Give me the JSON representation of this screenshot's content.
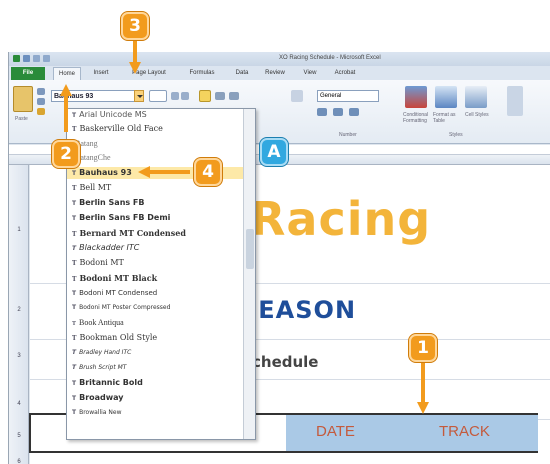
{
  "window": {
    "title": "XO Racing Schedule - Microsoft Excel"
  },
  "ribbon": {
    "tabs": [
      {
        "label": "File"
      },
      {
        "label": "Home"
      },
      {
        "label": "Insert"
      },
      {
        "label": "Page Layout"
      },
      {
        "label": "Formulas"
      },
      {
        "label": "Data"
      },
      {
        "label": "Review"
      },
      {
        "label": "View"
      },
      {
        "label": "Acrobat"
      }
    ],
    "paste_label": "Paste",
    "number_format": "General",
    "group_number": "Number",
    "group_styles": "Styles",
    "conditional_formatting": "Conditional Formatting",
    "format_as_table": "Format as Table",
    "cell_styles": "Cell Styles"
  },
  "font_list": {
    "items": [
      "Arial Unicode MS",
      "Baskerville Old Face",
      "Batang",
      "BatangChe",
      "Bauhaus 93",
      "Bell MT",
      "Berlin Sans FB",
      "Berlin Sans FB Demi",
      "Bernard MT Condensed",
      "Blackadder ITC",
      "Bodoni MT",
      "Bodoni MT Black",
      "Bodoni MT Condensed",
      "Bodoni MT Poster Compressed",
      "Book Antiqua",
      "Bookman Old Style",
      "Bradley Hand ITC",
      "Brush Script MT",
      "Britannic Bold",
      "Broadway",
      "Browallia New"
    ],
    "highlighted_index": 4
  },
  "sheet": {
    "row_numbers": [
      "1",
      "2",
      "3",
      "4",
      "5",
      "6"
    ],
    "title_text": "Racing",
    "season_text": "SEASON",
    "schedule_text": "chedule",
    "headers": {
      "date": "DATE",
      "track": "TRACK"
    }
  },
  "callouts": {
    "one": "1",
    "two": "2",
    "three": "3",
    "four": "4",
    "a": "A"
  },
  "colors": {
    "accent_orange": "#f29b1d",
    "accent_blue": "#31a8e0",
    "racing_title": "#f3b43a",
    "season_text": "#1f4e9a",
    "header_blue": "#aac9e6",
    "header_text": "#c45a3c",
    "font_highlight": "#fde9a8"
  }
}
